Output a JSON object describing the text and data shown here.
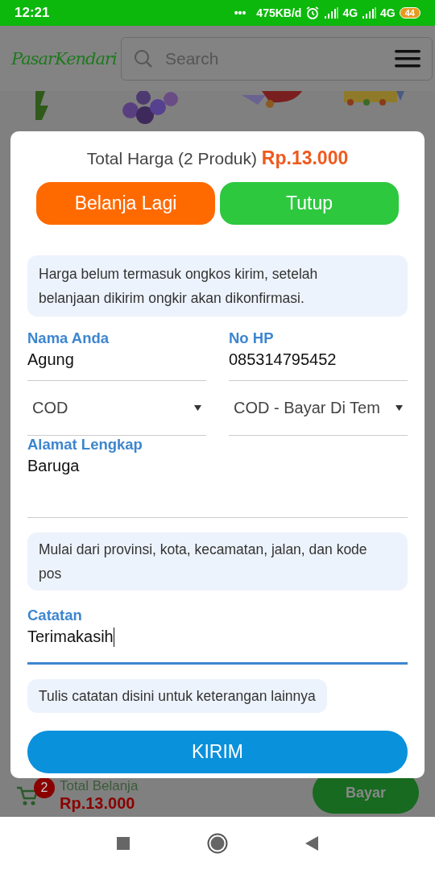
{
  "status_bar": {
    "time": "12:21",
    "dots": "•••",
    "speed": "475KB/d",
    "network_1": "4G",
    "network_2": "4G",
    "battery": "44"
  },
  "header": {
    "logo": "PasarKendari",
    "search": {
      "placeholder": "Search"
    }
  },
  "modal": {
    "title": "Total Harga (2 Produk)",
    "total": "Rp.13.000",
    "buttons": [
      {
        "label": "Belanja Lagi",
        "kind": "secondary"
      },
      {
        "label": "Tutup",
        "kind": "close"
      }
    ],
    "notice": "Harga belum termasuk ongkos kirim, setelah belanjaan dikirim ongkir akan dikonfirmasi.",
    "name_field": {
      "label": "Nama Anda",
      "value": "Agung"
    },
    "phone_field": {
      "label": "No HP",
      "value": "085314795452"
    },
    "courier_select": {
      "value": "COD"
    },
    "service_select": {
      "value": "COD - Bayar Di Tem"
    },
    "address_field": {
      "label": "Alamat Lengkap",
      "value": "Baruga",
      "hint": "Mulai dari provinsi, kota, kecamatan, jalan, dan kode pos",
      "focused": false
    },
    "note_field": {
      "label": "Catatan",
      "value": "Terimakasih",
      "hint": "Tulis catatan disini untuk keterangan lainnya",
      "focused": true
    },
    "submit": "KIRIM"
  },
  "cart_bar": {
    "badge": "2",
    "label": "Total Belanja",
    "total": "Rp.13.000",
    "pay": "Bayar"
  }
}
